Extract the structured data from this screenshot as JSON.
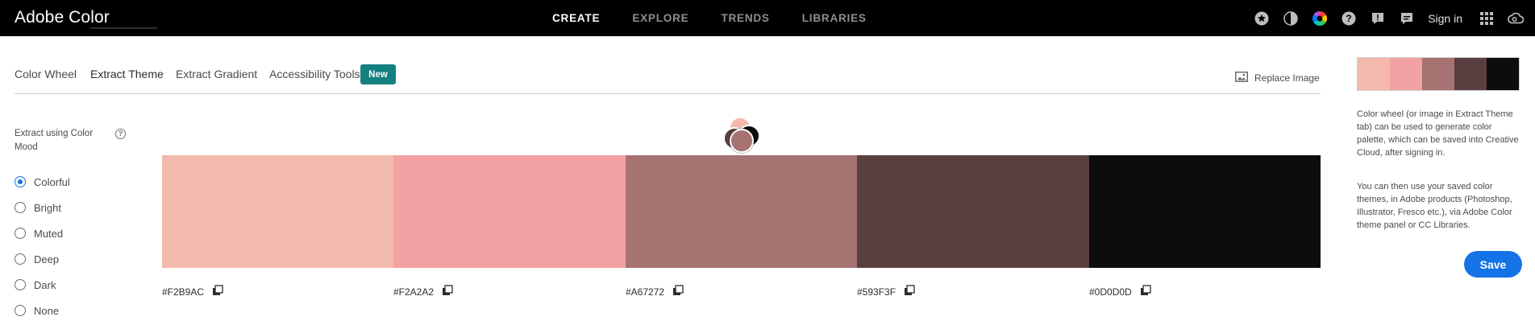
{
  "app": {
    "title": "Adobe Color"
  },
  "topnav": {
    "items": [
      {
        "label": "CREATE",
        "active": true
      },
      {
        "label": "EXPLORE",
        "active": false
      },
      {
        "label": "TRENDS",
        "active": false
      },
      {
        "label": "LIBRARIES",
        "active": false
      }
    ],
    "icons": [
      "star-icon",
      "theme-toggle-icon",
      "color-wheel-icon",
      "help-icon",
      "feedback-icon",
      "chat-icon",
      "apps-grid-icon",
      "creative-cloud-icon"
    ],
    "signin_label": "Sign in"
  },
  "tabs": {
    "items": [
      {
        "label": "Color Wheel",
        "active": false
      },
      {
        "label": "Extract Theme",
        "active": true
      },
      {
        "label": "Extract Gradient",
        "active": false
      },
      {
        "label": "Accessibility Tools",
        "active": false
      }
    ],
    "new_badge": "New",
    "replace_image_label": "Replace Image"
  },
  "extract": {
    "label": "Extract using Color Mood",
    "help_icon": "?",
    "moods": [
      {
        "label": "Colorful",
        "selected": true
      },
      {
        "label": "Bright",
        "selected": false
      },
      {
        "label": "Muted",
        "selected": false
      },
      {
        "label": "Deep",
        "selected": false
      },
      {
        "label": "Dark",
        "selected": false
      },
      {
        "label": "None",
        "selected": false
      }
    ]
  },
  "palette": {
    "swatches": [
      {
        "hex": "#F2B9AC",
        "color": "#F2B9AC"
      },
      {
        "hex": "#F2A2A2",
        "color": "#F2A2A2"
      },
      {
        "hex": "#A67272",
        "color": "#A67272"
      },
      {
        "hex": "#593F3F",
        "color": "#593F3F"
      },
      {
        "hex": "#0D0D0D",
        "color": "#0D0D0D"
      }
    ]
  },
  "sidebar": {
    "text1": "Color wheel (or image in Extract Theme tab) can be used to generate color palette, which can be saved into Creative Cloud, after signing in.",
    "text2": "You can then use your saved color themes, in Adobe products (Photoshop, Illustrator, Fresco etc.), via Adobe Color theme panel or CC Libraries.",
    "save_label": "Save"
  },
  "colors": {
    "topbar_bg": "#000000",
    "accent_blue": "#1473e6",
    "badge_teal": "#12807f"
  }
}
